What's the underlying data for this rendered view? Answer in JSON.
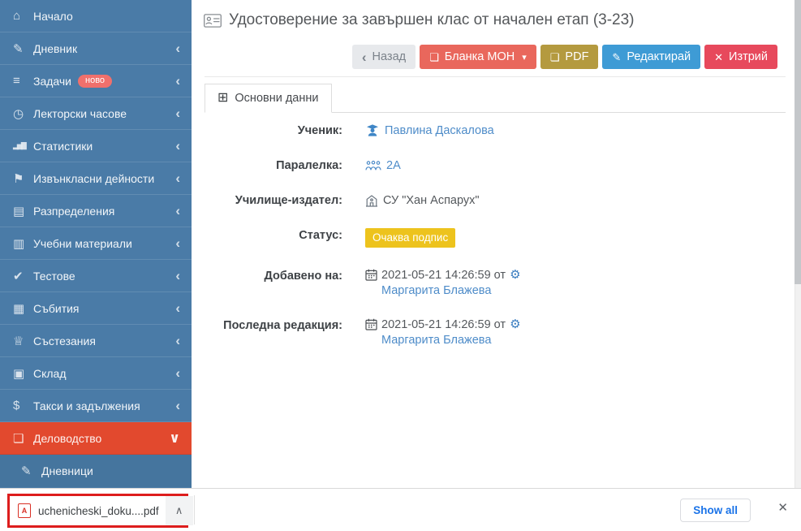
{
  "header": {
    "title": "Удостоверение за завършен клас от начален етап (3-23)"
  },
  "toolbar": {
    "back_label": "Назад",
    "blanka_label": "Бланка МОН",
    "pdf_label": "PDF",
    "edit_label": "Редактирай",
    "delete_label": "Изтрий"
  },
  "tab": {
    "label": "Основни данни"
  },
  "fields": {
    "student": {
      "label": "Ученик:",
      "value": "Павлина Даскалова"
    },
    "class": {
      "label": "Паралелка:",
      "value": "2А"
    },
    "school": {
      "label": "Училище-издател:",
      "value": "СУ \"Хан Аспарух\""
    },
    "status": {
      "label": "Статус:",
      "value": "Очаква подпис"
    },
    "added": {
      "label": "Добавено на:",
      "date": "2021-05-21 14:26:59 от",
      "by": "Маргарита Блажева"
    },
    "edited": {
      "label": "Последна редакция:",
      "date": "2021-05-21 14:26:59 от",
      "by": "Маргарита Блажева"
    }
  },
  "sidebar": {
    "items": [
      {
        "label": "Начало"
      },
      {
        "label": "Дневник"
      },
      {
        "label": "Задачи",
        "badge": "ново"
      },
      {
        "label": "Лекторски часове"
      },
      {
        "label": "Статистики"
      },
      {
        "label": "Извънкласни дейности"
      },
      {
        "label": "Разпределения"
      },
      {
        "label": "Учебни материали"
      },
      {
        "label": "Тестове"
      },
      {
        "label": "Събития"
      },
      {
        "label": "Състезания"
      },
      {
        "label": "Склад"
      },
      {
        "label": "Такси и задължения"
      },
      {
        "label": "Деловодство"
      },
      {
        "label": "Дневници"
      }
    ]
  },
  "download_bar": {
    "filename": "uchenicheski_doku....pdf",
    "pdf_mark": "A",
    "show_all_label": "Show all"
  },
  "icons": {
    "home": "⌂",
    "journal": "✎",
    "tasks": "≡",
    "clock": "◷",
    "chart": "▂▅▇",
    "running": "⚑",
    "table": "▤",
    "books": "▥",
    "spellcheck": "✔",
    "calendar": "▦",
    "trophy": "♕",
    "warehouse": "▣",
    "money": "$",
    "document": "❏",
    "edit": "✎",
    "chevron_left": "‹",
    "chevron_down": "∨",
    "caret_down": "▾",
    "file_pdf": "❏",
    "close_x": "✕",
    "grid": "⊞",
    "gear": "⚙",
    "chevron_up": "∧"
  },
  "colors": {
    "sidebar_bg": "#4a7ba7",
    "sidebar_active_bg": "#e2492e",
    "submenu_bg": "#45759e",
    "link": "#4e8cc9",
    "status_badge_bg": "#edc31d",
    "badge_new_bg": "#f0706c",
    "btn_blanka_bg": "#e9675c",
    "btn_pdf_bg": "#b49a3f",
    "btn_edit_bg": "#3e9bd5",
    "btn_delete_bg": "#e7495c",
    "annotation_red": "#dd1d1d",
    "show_all_text": "#1a73e8"
  }
}
